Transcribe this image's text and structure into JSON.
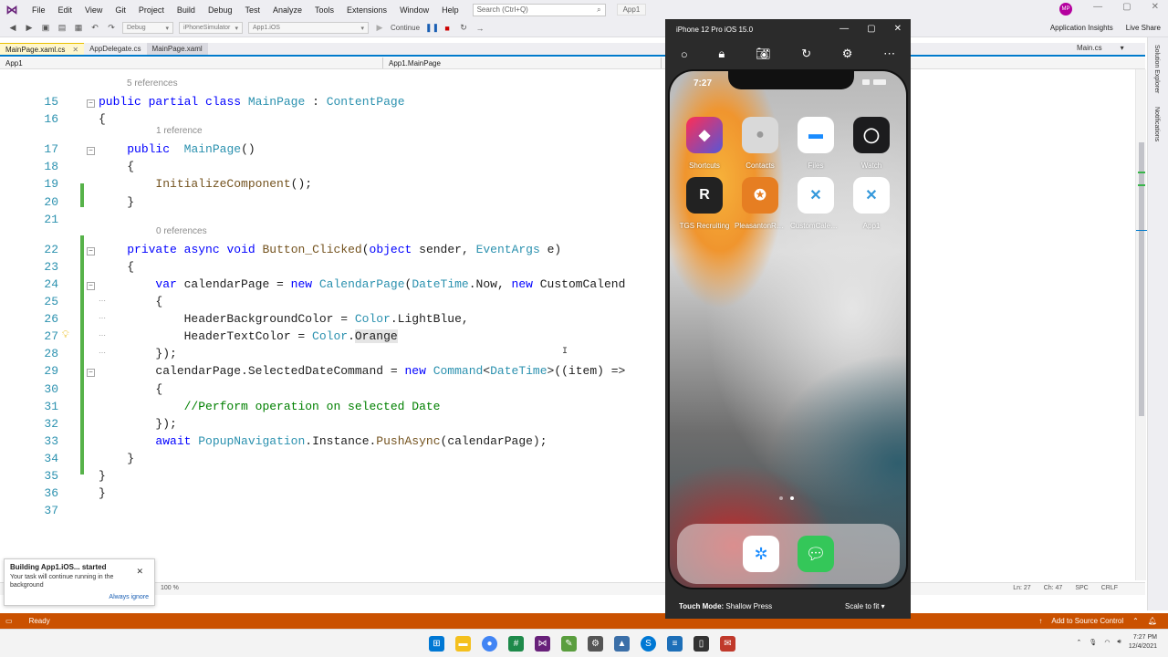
{
  "menu": {
    "items": [
      "File",
      "Edit",
      "View",
      "Git",
      "Project",
      "Build",
      "Debug",
      "Test",
      "Analyze",
      "Tools",
      "Extensions",
      "Window",
      "Help"
    ],
    "search_placeholder": "Search (Ctrl+Q)",
    "app_title": "App1",
    "user_initials": "MP"
  },
  "toolbar": {
    "config": "Debug",
    "platform": "iPhoneSimulator",
    "project": "App1.iOS",
    "continue_label": "Continue",
    "app_insights": "Application Insights",
    "live_share": "Live Share"
  },
  "tabs": [
    {
      "label": "MainPage.xaml.cs",
      "active": true
    },
    {
      "label": "AppDelegate.cs",
      "active": false
    },
    {
      "label": "MainPage.xaml",
      "active": false
    }
  ],
  "tab_right": "Main.cs",
  "navbar": {
    "project": "App1",
    "type": "App1.MainPage"
  },
  "side_labels": [
    "Solution Explorer",
    "Notifications"
  ],
  "code": {
    "lines": [
      {
        "n": "15",
        "lens": "5 references",
        "html": "<span class='kw'>public</span> <span class='kw'>partial</span> <span class='kw'>class</span> <span class='ty'>MainPage</span> : <span class='ty'>ContentPage</span>"
      },
      {
        "n": "16",
        "html": "{"
      },
      {
        "n": "17",
        "lens": "1 reference",
        "html": "    <span class='kw'>public</span>  <span class='ty'>MainPage</span>()"
      },
      {
        "n": "18",
        "html": "    {"
      },
      {
        "n": "19",
        "html": "        <span class='mt'>InitializeComponent</span>();"
      },
      {
        "n": "20",
        "html": "    }"
      },
      {
        "n": "21",
        "html": ""
      },
      {
        "n": "22",
        "lens": "0 references",
        "html": "    <span class='kw'>private</span> <span class='kw'>async</span> <span class='kw'>void</span> <span class='mt'>Button_Clicked</span>(<span class='kw'>object</span> sender, <span class='ty'>EventArgs</span> e)"
      },
      {
        "n": "23",
        "html": "    {"
      },
      {
        "n": "24",
        "html": "        <span class='kw'>var</span> calendarPage = <span class='kw'>new</span> <span class='ty'>CalendarPage</span>(<span class='ty'>DateTime</span>.Now, <span class='kw'>new</span> CustomCalend"
      },
      {
        "n": "25",
        "html": "        {"
      },
      {
        "n": "26",
        "html": "            HeaderBackgroundColor = <span class='ty'>Color</span>.LightBlue,"
      },
      {
        "n": "27",
        "html": "            HeaderTextColor = <span class='ty'>Color</span>.<span class='hl'>Orange</span>"
      },
      {
        "n": "28",
        "html": "        });"
      },
      {
        "n": "29",
        "html": "        calendarPage.SelectedDateCommand = <span class='kw'>new</span> <span class='ty'>Command</span>&lt;<span class='ty'>DateTime</span>&gt;((item) =>"
      },
      {
        "n": "30",
        "html": "        {"
      },
      {
        "n": "31",
        "html": "            <span class='cm'>//Perform operation on selected Date</span>"
      },
      {
        "n": "32",
        "html": "        });"
      },
      {
        "n": "33",
        "html": "        <span class='kw'>await</span> <span class='ty'>PopupNavigation</span>.Instance.<span class='mt'>PushAsync</span>(calendarPage);"
      },
      {
        "n": "34",
        "html": "    }"
      },
      {
        "n": "35",
        "html": "}"
      },
      {
        "n": "36",
        "html": "}"
      },
      {
        "n": "37",
        "html": ""
      }
    ]
  },
  "editor_status": {
    "zoom": "100 %",
    "ln": "Ln: 27",
    "ch": "Ch: 47",
    "spc": "SPC",
    "crlf": "CRLF"
  },
  "toast": {
    "title": "Building App1.iOS... started",
    "body": "Your task will continue running in the background",
    "link": "Always ignore"
  },
  "statusbar": {
    "ready": "Ready",
    "source_control": "Add to Source Control"
  },
  "taskbar": {
    "time": "7:27 PM",
    "date": "12/4/2021"
  },
  "simulator": {
    "title": "iPhone 12 Pro iOS 15.0",
    "time": "7:27",
    "apps": [
      "Shortcuts",
      "Contacts",
      "Files",
      "Watch",
      "TGS Recruiting",
      "PleasantonRag...",
      "CustomCalend...",
      "App1"
    ],
    "touch_mode_label": "Touch Mode:",
    "touch_mode_value": "Shallow Press",
    "scale": "Scale to fit"
  }
}
